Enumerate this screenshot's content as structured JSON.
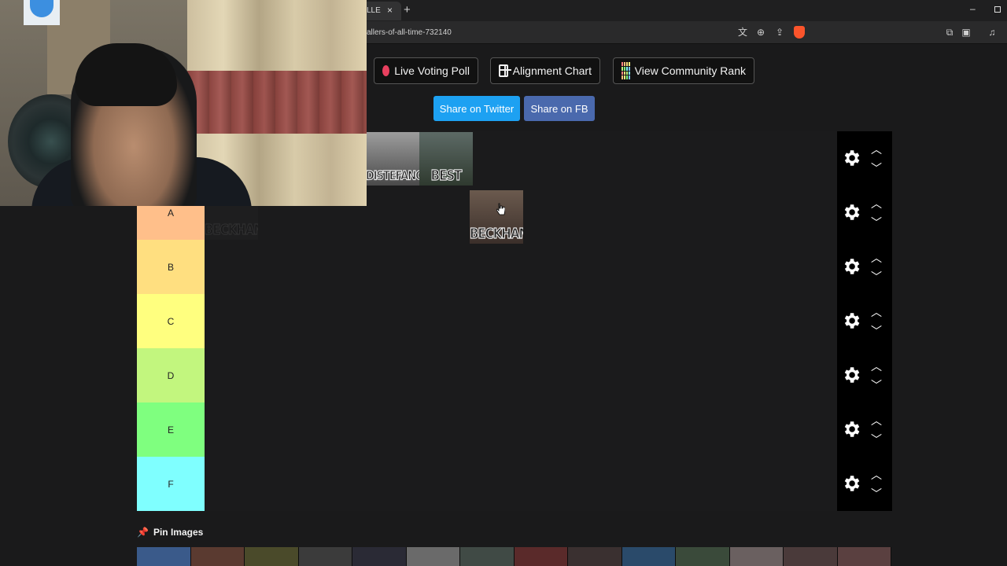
{
  "browser": {
    "tab_title": "LLE",
    "tab_close": "×",
    "new_tab": "+",
    "url": "allers-of-all-time-732140",
    "window_minimize": "–"
  },
  "actions": {
    "live_voting_poll": "Live Voting Poll",
    "alignment_chart": "Alignment Chart",
    "view_community_rank": "View Community Rank",
    "share_twitter": "Share on Twitter",
    "share_fb": "Share on FB"
  },
  "tiers": [
    {
      "label": "",
      "color": "#1b1b1c",
      "items": [
        "DISTEFANO",
        "BEST"
      ]
    },
    {
      "label": "A",
      "color": "#ffbf8a",
      "items": [
        "BECKHAM"
      ]
    },
    {
      "label": "B",
      "color": "#ffdf80",
      "items": []
    },
    {
      "label": "C",
      "color": "#ffff7f",
      "items": []
    },
    {
      "label": "D",
      "color": "#c2f67e",
      "items": []
    },
    {
      "label": "E",
      "color": "#7fff7f",
      "items": []
    },
    {
      "label": "F",
      "color": "#7fffff",
      "items": []
    }
  ],
  "dragging_item": "BECKHAM",
  "pin_images": {
    "label": "Pin Images",
    "thumbnail_count": 14
  },
  "colors": {
    "twitter": "#1da1f2",
    "facebook": "#4a69ad",
    "record": "#e8405f",
    "brave": "#fb542b"
  }
}
